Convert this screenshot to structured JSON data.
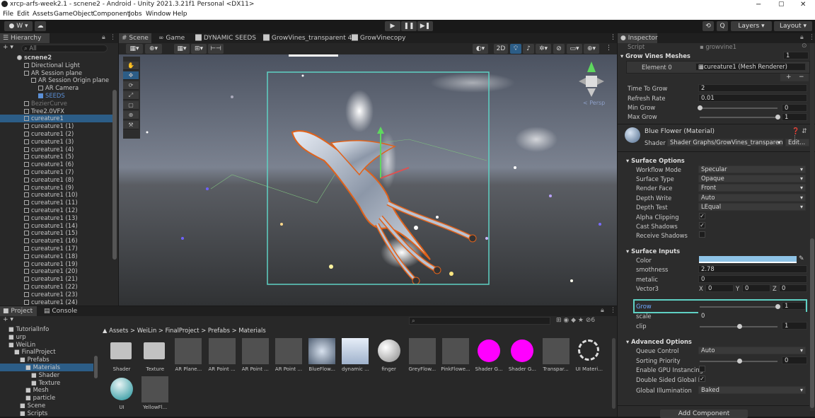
{
  "title_bar": {
    "text": "xrcp-arfs-week2.1 - scnene2 - Android - Unity 2021.3.21f1 Personal <DX11>",
    "min": "−",
    "max": "▢",
    "close": "✕"
  },
  "menu": [
    "File",
    "Edit",
    "Assets",
    "GameObject",
    "Component",
    "Jobs",
    "Window",
    "Help"
  ],
  "toolbar": {
    "account": "W ▾",
    "cloud": "☁",
    "play": "▶",
    "pause": "❚❚",
    "step": "▶❚",
    "history": "⟲",
    "search": "Q",
    "layers": "Layers",
    "layout": "Layout"
  },
  "hierarchy": {
    "tab": "Hierarchy",
    "search_placeholder": "All",
    "add": "+ ▾",
    "items": [
      {
        "label": "scnene2",
        "depth": 0,
        "kind": "scene"
      },
      {
        "label": "Directional Light",
        "depth": 1
      },
      {
        "label": "AR Session plane",
        "depth": 1
      },
      {
        "label": "AR Session Origin plane",
        "depth": 2
      },
      {
        "label": "AR Camera",
        "depth": 3
      },
      {
        "label": "SEEDS",
        "depth": 3,
        "kind": "prefab"
      },
      {
        "label": "BezierCurve",
        "depth": 1,
        "kind": "disabled"
      },
      {
        "label": "Tree2.0VFX",
        "depth": 1
      },
      {
        "label": "cureature1",
        "depth": 1,
        "selected": true
      },
      {
        "label": "cureature1 (1)",
        "depth": 1
      },
      {
        "label": "cureature1 (2)",
        "depth": 1
      },
      {
        "label": "cureature1 (3)",
        "depth": 1
      },
      {
        "label": "cureature1 (4)",
        "depth": 1
      },
      {
        "label": "cureature1 (5)",
        "depth": 1
      },
      {
        "label": "cureature1 (6)",
        "depth": 1
      },
      {
        "label": "cureature1 (7)",
        "depth": 1
      },
      {
        "label": "cureature1 (8)",
        "depth": 1
      },
      {
        "label": "cureature1 (9)",
        "depth": 1
      },
      {
        "label": "cureature1 (10)",
        "depth": 1
      },
      {
        "label": "cureature1 (11)",
        "depth": 1
      },
      {
        "label": "cureature1 (12)",
        "depth": 1
      },
      {
        "label": "cureature1 (13)",
        "depth": 1
      },
      {
        "label": "cureature1 (14)",
        "depth": 1
      },
      {
        "label": "cureature1 (15)",
        "depth": 1
      },
      {
        "label": "cureature1 (16)",
        "depth": 1
      },
      {
        "label": "cureature1 (17)",
        "depth": 1
      },
      {
        "label": "cureature1 (18)",
        "depth": 1
      },
      {
        "label": "cureature1 (19)",
        "depth": 1
      },
      {
        "label": "cureature1 (20)",
        "depth": 1
      },
      {
        "label": "cureature1 (21)",
        "depth": 1
      },
      {
        "label": "cureature1 (22)",
        "depth": 1
      },
      {
        "label": "cureature1 (23)",
        "depth": 1
      },
      {
        "label": "cureature1 (24)",
        "depth": 1
      }
    ]
  },
  "scene_tabs": [
    "# Scene",
    "∞ Game",
    "DYNAMIC SEEDS",
    "GrowVines_transparent 4*",
    "GrowVinecopy"
  ],
  "scene_toolbar": {
    "mode_2d": "2D",
    "persp": "< Persp"
  },
  "tools": [
    "✋",
    "✥",
    "⟳",
    "⤢",
    "▢",
    "⊕",
    "⚒"
  ],
  "project": {
    "tabs": [
      "Project",
      "Console"
    ],
    "breadcrumb": "▲ Assets > WeiLin > FinalProject > Prefabs > Materials",
    "search_placeholder": "",
    "count": "6",
    "tree": [
      {
        "label": "TutorialInfo",
        "depth": 1
      },
      {
        "label": "urp",
        "depth": 1
      },
      {
        "label": "WeiLin",
        "depth": 1
      },
      {
        "label": "FinalProject",
        "depth": 2
      },
      {
        "label": "Prefabs",
        "depth": 3
      },
      {
        "label": "Materials",
        "depth": 4,
        "selected": true
      },
      {
        "label": "Shader",
        "depth": 5
      },
      {
        "label": "Texture",
        "depth": 5
      },
      {
        "label": "Mesh",
        "depth": 4
      },
      {
        "label": "particle",
        "depth": 4
      },
      {
        "label": "Scene",
        "depth": 3
      },
      {
        "label": "Scripts",
        "depth": 3
      }
    ],
    "assets": [
      {
        "label": "Shader",
        "kind": "folder"
      },
      {
        "label": "Texture",
        "kind": "folder"
      },
      {
        "label": "AR Plane...",
        "kind": "grey"
      },
      {
        "label": "AR Point ...",
        "kind": "grey"
      },
      {
        "label": "AR Point ...",
        "kind": "grey"
      },
      {
        "label": "AR Point ...",
        "kind": "grey"
      },
      {
        "label": "BlueFlow...",
        "kind": "flower"
      },
      {
        "label": "dynamic ...",
        "kind": "sky"
      },
      {
        "label": "finger",
        "kind": "sphere"
      },
      {
        "label": "GreyFlow...",
        "kind": "grey"
      },
      {
        "label": "PinkFlowe...",
        "kind": "grey"
      },
      {
        "label": "Shader G...",
        "kind": "magenta"
      },
      {
        "label": "Shader G...",
        "kind": "magenta"
      },
      {
        "label": "Transpar...",
        "kind": "grey"
      },
      {
        "label": "UI Materi...",
        "kind": "ui"
      },
      {
        "label": "UI",
        "kind": "teal"
      },
      {
        "label": "YellowFl...",
        "kind": "grey"
      }
    ]
  },
  "inspector": {
    "tab": "Inspector",
    "script_label": "Script",
    "script_value": "growvine1",
    "grow_vines_meshes": "Grow Vines Meshes",
    "meshes_count": "1",
    "element0_label": "Element 0",
    "element0_value": "cureature1 (Mesh Renderer)",
    "plus": "+",
    "minus": "−",
    "time_to_grow_label": "Time To Grow",
    "time_to_grow": "2",
    "refresh_rate_label": "Refresh Rate",
    "refresh_rate": "0.01",
    "min_grow_label": "Min Grow",
    "min_grow": "0",
    "max_grow_label": "Max Grow",
    "max_grow": "1",
    "material_title": "Blue Flower (Material)",
    "shader_label": "Shader",
    "shader_value": "Shader Graphs/GrowVines_transparent",
    "edit_label": "Edit...",
    "surface_options": "Surface Options",
    "workflow_mode_label": "Workflow Mode",
    "workflow_mode": "Specular",
    "surface_type_label": "Surface Type",
    "surface_type": "Opaque",
    "render_face_label": "Render Face",
    "render_face": "Front",
    "depth_write_label": "Depth Write",
    "depth_write": "Auto",
    "depth_test_label": "Depth Test",
    "depth_test": "LEqual",
    "alpha_clipping_label": "Alpha Clipping",
    "cast_shadows_label": "Cast Shadows",
    "receive_shadows_label": "Receive Shadows",
    "surface_inputs": "Surface Inputs",
    "color_label": "Color",
    "color_value": "#8ec3e6",
    "smoothness_label": "smothness",
    "smoothness": "2.78",
    "metalic_label": "metalic",
    "metalic": "0",
    "vector3_label": "Vector3",
    "vx_label": "X",
    "vx": "0",
    "vy_label": "Y",
    "vy": "0",
    "vz_label": "Z",
    "vz": "0",
    "grow_label": "Grow",
    "grow": "1",
    "scale_label": "scale",
    "scale": "0",
    "clip_label": "clip",
    "clip": "1",
    "advanced_options": "Advanced Options",
    "queue_control_label": "Queue Control",
    "queue_control": "Auto",
    "sorting_priority_label": "Sorting Priority",
    "sorting_priority": "0",
    "gpu_instancing_label": "Enable GPU Instancing",
    "double_sided_gi_label": "Double Sided Global Il",
    "global_illumination_label": "Global Illumination",
    "global_illumination": "Baked",
    "add_component": "Add Component"
  },
  "colors": {
    "accent": "#2c5d87",
    "selection_box": "#5fd1c4",
    "outline": "#e0621b",
    "play_bar": "#3a3a3a"
  }
}
